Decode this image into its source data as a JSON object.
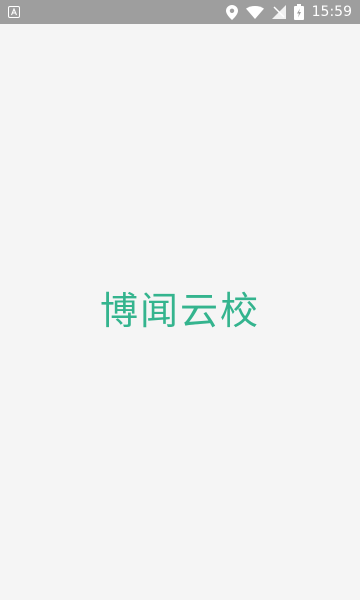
{
  "status_bar": {
    "time": "15:59",
    "icons": [
      "android-notification-icon",
      "location-pin-icon",
      "wifi-icon",
      "no-sim-icon",
      "battery-icon"
    ],
    "background_color": "#9e9e9e"
  },
  "splash": {
    "app_name": "博闻云校",
    "text_color": "#34b48e",
    "background_color": "#f5f5f5"
  }
}
